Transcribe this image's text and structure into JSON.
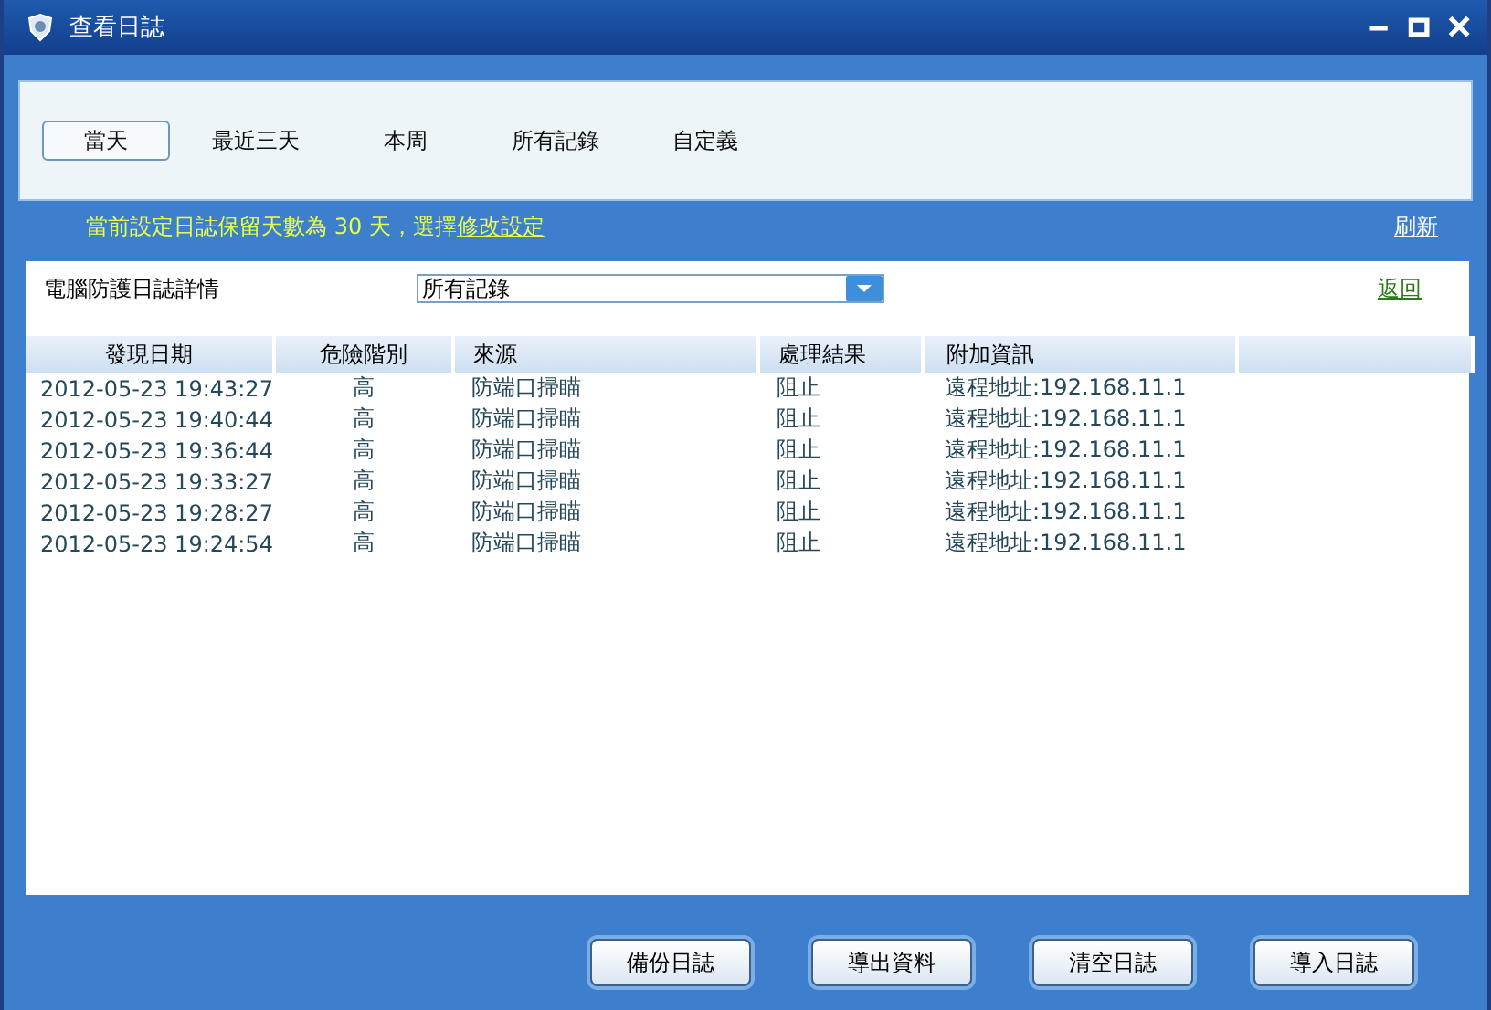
{
  "window": {
    "title": "查看日誌"
  },
  "filters": [
    {
      "label": "當天",
      "selected": true
    },
    {
      "label": "最近三天",
      "selected": false
    },
    {
      "label": "本周",
      "selected": false
    },
    {
      "label": "所有記錄",
      "selected": false
    },
    {
      "label": "自定義",
      "selected": false
    }
  ],
  "notice": {
    "text": "當前設定日誌保留天數為 30 天，選擇",
    "link": "修改設定"
  },
  "refresh_link": "刷新",
  "detail_label": "電腦防護日誌詳情",
  "type_dropdown": {
    "value": "所有記錄"
  },
  "back_link": "返回",
  "table": {
    "columns": [
      "發現日期",
      "危險階別",
      "來源",
      "處理結果",
      "附加資訊"
    ],
    "rows": [
      [
        "2012-05-23 19:43:27",
        "高",
        "防端口掃瞄",
        "阻止",
        "遠程地址:192.168.11.1"
      ],
      [
        "2012-05-23 19:40:44",
        "高",
        "防端口掃瞄",
        "阻止",
        "遠程地址:192.168.11.1"
      ],
      [
        "2012-05-23 19:36:44",
        "高",
        "防端口掃瞄",
        "阻止",
        "遠程地址:192.168.11.1"
      ],
      [
        "2012-05-23 19:33:27",
        "高",
        "防端口掃瞄",
        "阻止",
        "遠程地址:192.168.11.1"
      ],
      [
        "2012-05-23 19:28:27",
        "高",
        "防端口掃瞄",
        "阻止",
        "遠程地址:192.168.11.1"
      ],
      [
        "2012-05-23 19:24:54",
        "高",
        "防端口掃瞄",
        "阻止",
        "遠程地址:192.168.11.1"
      ]
    ]
  },
  "buttons": [
    "備份日誌",
    "導出資料",
    "清空日誌",
    "導入日誌"
  ]
}
